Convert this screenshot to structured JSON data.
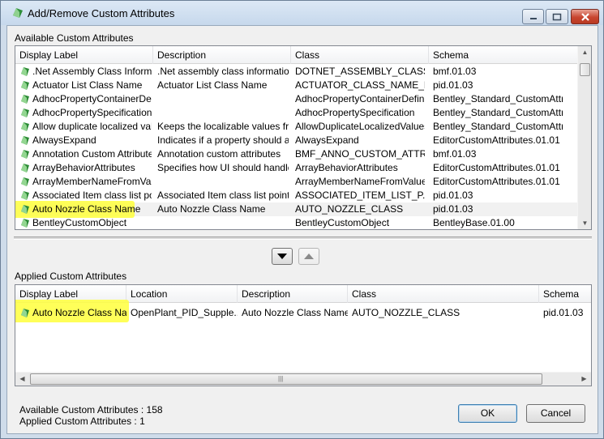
{
  "window": {
    "title": "Add/Remove Custom Attributes"
  },
  "colors": {
    "highlight": "#ffff3c",
    "title_bar": "#c6d8ec",
    "close_button": "#c8452f"
  },
  "available": {
    "group_label": "Available Custom Attributes",
    "columns": [
      "Display Label",
      "Description",
      "Class",
      "Schema"
    ],
    "rows": [
      {
        "label": ".Net Assembly Class Informat...",
        "description": ".Net assembly class information",
        "class": "DOTNET_ASSEMBLY_CLASS...",
        "schema": "bmf.01.03"
      },
      {
        "label": "Actuator List Class Name",
        "description": "Actuator List Class Name",
        "class": "ACTUATOR_CLASS_NAME_L...",
        "schema": "pid.01.03"
      },
      {
        "label": "AdhocPropertyContainerDefi...",
        "description": "",
        "class": "AdhocPropertyContainerDefiniti...",
        "schema": "Bentley_Standard_CustomAttrib..."
      },
      {
        "label": "AdhocPropertySpecification",
        "description": "",
        "class": "AdhocPropertySpecification",
        "schema": "Bentley_Standard_CustomAttrib..."
      },
      {
        "label": "Allow duplicate localized val...",
        "description": "Keeps the localizable values fro...",
        "class": "AllowDuplicateLocalizedValues",
        "schema": "Bentley_Standard_CustomAttrib..."
      },
      {
        "label": "AlwaysExpand",
        "description": "Indicates if a property should al...",
        "class": "AlwaysExpand",
        "schema": "EditorCustomAttributes.01.01"
      },
      {
        "label": "Annotation Custom Attributes",
        "description": "Annotation custom attributes",
        "class": "BMF_ANNO_CUSTOM_ATTRI...",
        "schema": "bmf.01.03"
      },
      {
        "label": "ArrayBehaviorAttributes",
        "description": "Specifies how UI should handle...",
        "class": "ArrayBehaviorAttributes",
        "schema": "EditorCustomAttributes.01.01"
      },
      {
        "label": "ArrayMemberNameFromValue",
        "description": "",
        "class": "ArrayMemberNameFromValue",
        "schema": "EditorCustomAttributes.01.01"
      },
      {
        "label": "Associated Item class list poi...",
        "description": "Associated Item class list pointer",
        "class": "ASSOCIATED_ITEM_LIST_P...",
        "schema": "pid.01.03"
      },
      {
        "label": "Auto Nozzle Class Name",
        "description": "Auto Nozzle Class Name",
        "class": "AUTO_NOZZLE_CLASS",
        "schema": "pid.01.03",
        "selected": true
      },
      {
        "label": "BentleyCustomObject",
        "description": "",
        "class": "BentleyCustomObject",
        "schema": "BentleyBase.01.00"
      }
    ]
  },
  "applied": {
    "group_label": "Applied Custom Attributes",
    "columns": [
      "Display Label",
      "Location",
      "Description",
      "Class",
      "Schema"
    ],
    "rows": [
      {
        "label": "Auto Nozzle Class Na...",
        "location": "OpenPlant_PID_Supple...",
        "description": "Auto Nozzle Class Name",
        "class": "AUTO_NOZZLE_CLASS",
        "schema": "pid.01.03"
      }
    ]
  },
  "move_buttons": {
    "down_icon": "triangle-down-icon",
    "up_icon": "triangle-up-icon"
  },
  "status": {
    "available_count": "Available Custom Attributes : 158",
    "applied_count": "Applied Custom Attributes : 1"
  },
  "buttons": {
    "ok": "OK",
    "cancel": "Cancel"
  },
  "scroll_glyphs": {
    "up": "▲",
    "down": "▼",
    "left": "◀",
    "right": "▶",
    "grip": "|||"
  }
}
